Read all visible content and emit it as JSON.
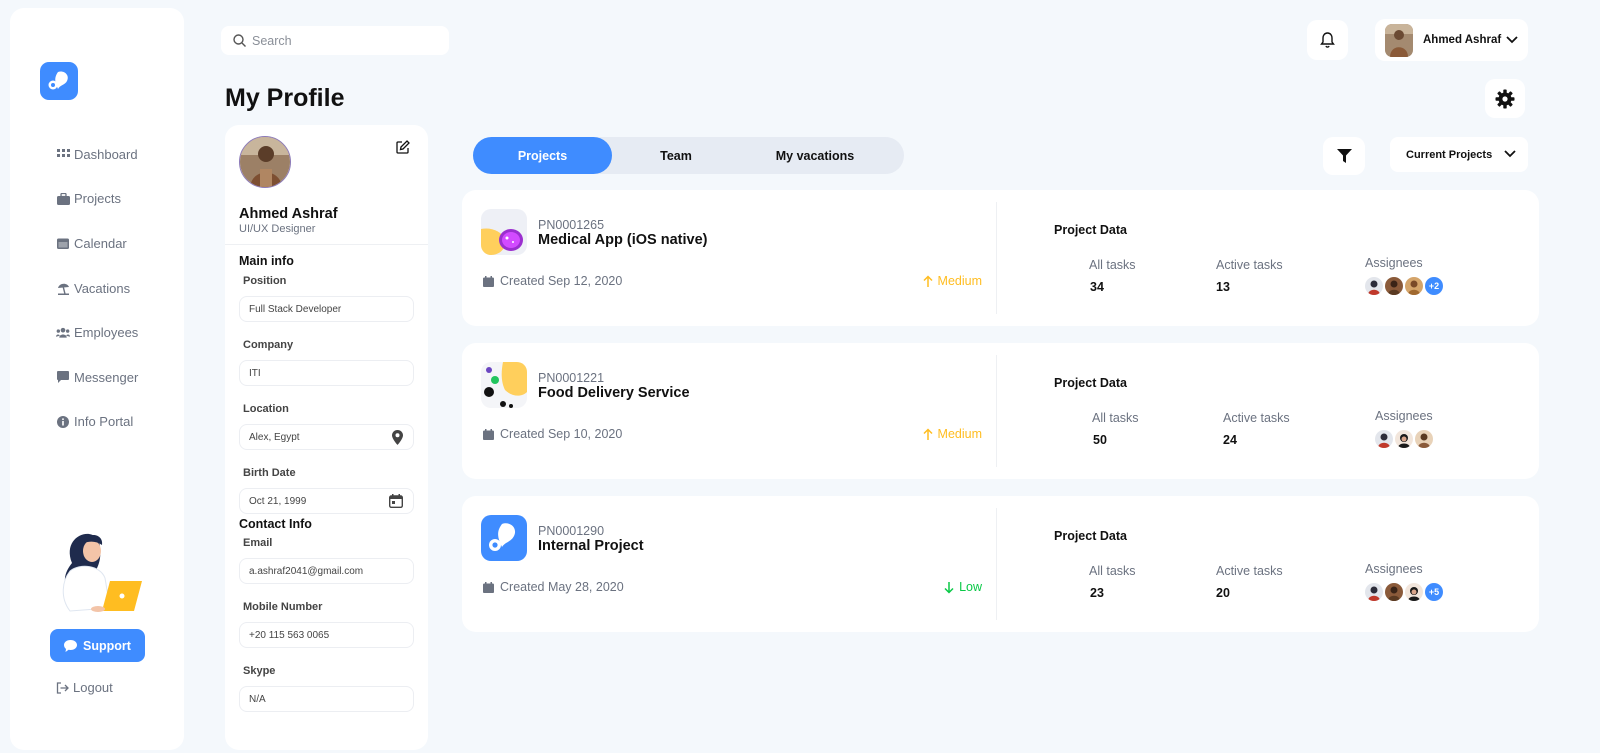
{
  "search": {
    "placeholder": "Search"
  },
  "user": {
    "name": "Ahmed Ashraf"
  },
  "page_title": "My Profile",
  "sidebar": {
    "items": [
      {
        "label": "Dashboard",
        "icon": "grid-icon"
      },
      {
        "label": "Projects",
        "icon": "briefcase-icon"
      },
      {
        "label": "Calendar",
        "icon": "calendar-icon"
      },
      {
        "label": "Vacations",
        "icon": "beach-icon"
      },
      {
        "label": "Employees",
        "icon": "users-icon"
      },
      {
        "label": "Messenger",
        "icon": "chat-icon"
      },
      {
        "label": "Info Portal",
        "icon": "info-icon"
      }
    ],
    "support_label": "Support",
    "logout_label": "Logout"
  },
  "profile": {
    "name": "Ahmed Ashraf",
    "role": "UI/UX Designer",
    "main_info_title": "Main info",
    "contact_info_title": "Contact Info",
    "fields": {
      "position": {
        "label": "Position",
        "value": "Full Stack Developer"
      },
      "company": {
        "label": "Company",
        "value": "ITI"
      },
      "location": {
        "label": "Location",
        "value": "Alex, Egypt"
      },
      "birth_date": {
        "label": "Birth Date",
        "value": "Oct 21, 1999"
      },
      "email": {
        "label": "Email",
        "value": "a.ashraf2041@gmail.com"
      },
      "mobile": {
        "label": "Mobile Number",
        "value": "+20 115 563 0065"
      },
      "skype": {
        "label": "Skype",
        "value": "N/A"
      }
    }
  },
  "tabs": [
    {
      "label": "Projects",
      "active": true
    },
    {
      "label": "Team",
      "active": false
    },
    {
      "label": "My vacations",
      "active": false
    }
  ],
  "project_filter": {
    "selected": "Current Projects"
  },
  "projects": [
    {
      "id": "PN0001265",
      "name": "Medical App (iOS native)",
      "created": "Created Sep 12, 2020",
      "priority": "Medium",
      "priority_dir": "up",
      "priority_color": "#ffbd21",
      "data_title": "Project Data",
      "all_tasks_label": "All tasks",
      "all_tasks": "34",
      "active_tasks_label": "Active tasks",
      "active_tasks": "13",
      "assignees_label": "Assignees",
      "assignees_extra": "+2"
    },
    {
      "id": "PN0001221",
      "name": "Food Delivery Service",
      "created": "Created Sep 10, 2020",
      "priority": "Medium",
      "priority_dir": "up",
      "priority_color": "#ffbd21",
      "data_title": "Project Data",
      "all_tasks_label": "All tasks",
      "all_tasks": "50",
      "active_tasks_label": "Active tasks",
      "active_tasks": "24",
      "assignees_label": "Assignees",
      "assignees_extra": ""
    },
    {
      "id": "PN0001290",
      "name": "Internal Project",
      "created": "Created May 28, 2020",
      "priority": "Low",
      "priority_dir": "down",
      "priority_color": "#0ac947",
      "data_title": "Project Data",
      "all_tasks_label": "All tasks",
      "all_tasks": "23",
      "active_tasks_label": "Active tasks",
      "active_tasks": "20",
      "assignees_label": "Assignees",
      "assignees_extra": "+5"
    }
  ],
  "colors": {
    "accent": "#3f8cff",
    "background": "#f4f8fc",
    "medium": "#ffbd21",
    "low": "#0ac947"
  }
}
